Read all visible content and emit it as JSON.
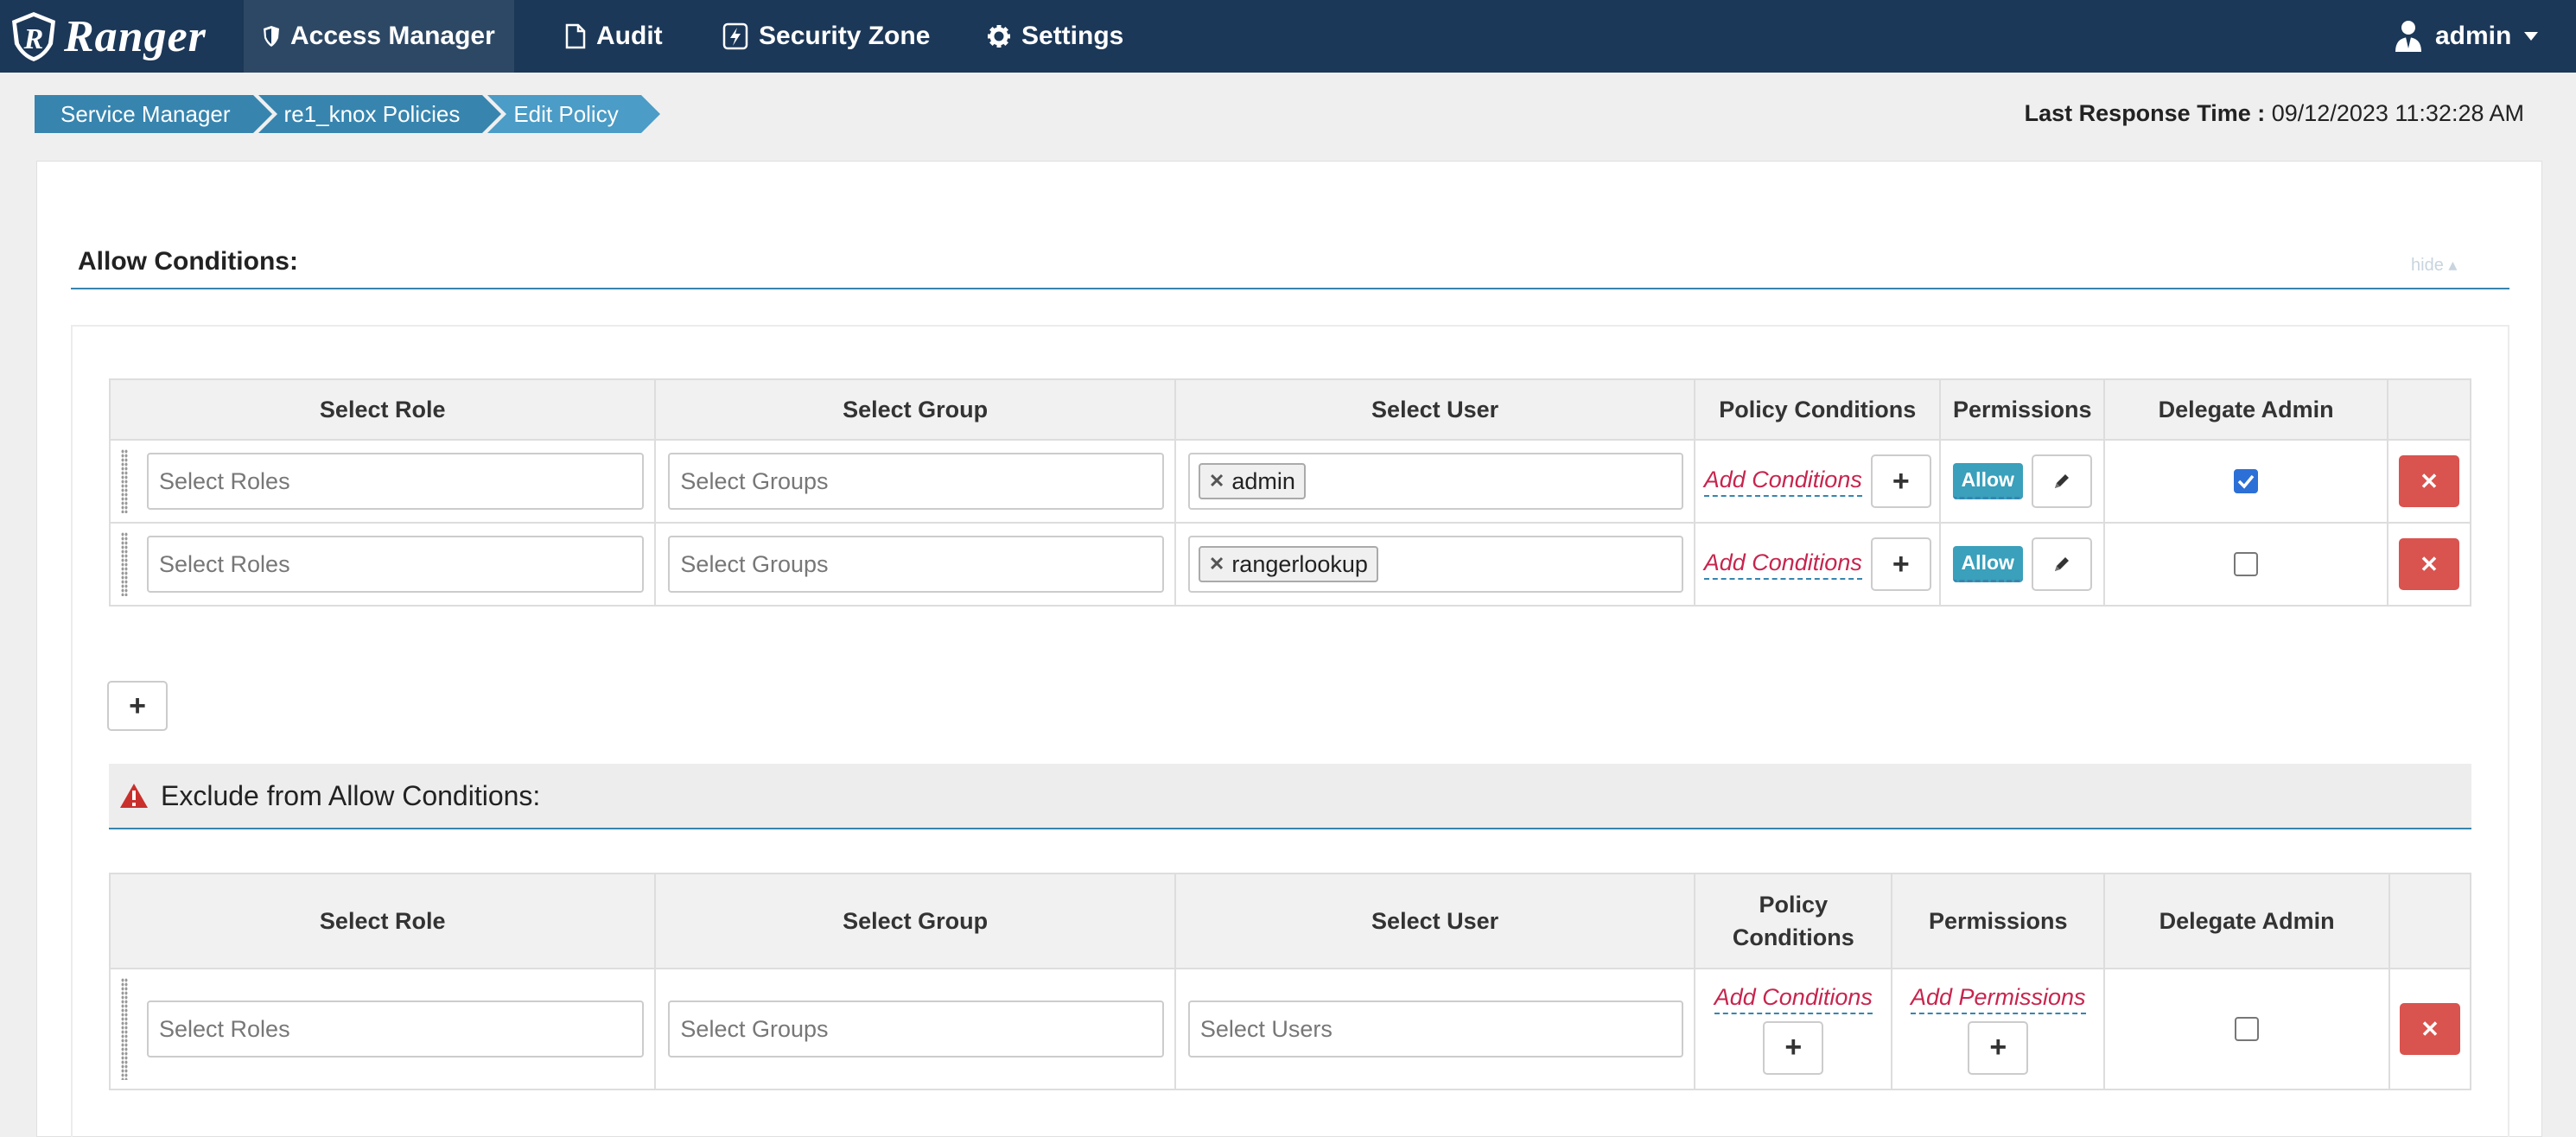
{
  "nav": {
    "brand": "Ranger",
    "items": [
      {
        "label": "Access Manager",
        "icon": "shield-icon"
      },
      {
        "label": "Audit",
        "icon": "file-icon"
      },
      {
        "label": "Security Zone",
        "icon": "bolt-icon"
      },
      {
        "label": "Settings",
        "icon": "gear-icon"
      }
    ],
    "user": "admin"
  },
  "breadcrumb": [
    "Service Manager",
    "re1_knox Policies",
    "Edit Policy"
  ],
  "last_response": {
    "label": "Last Response Time :",
    "value": "09/12/2023 11:32:28 AM"
  },
  "allow": {
    "title": "Allow Conditions:",
    "hide_label": "hide",
    "headers": [
      "Select Role",
      "Select Group",
      "Select User",
      "Policy Conditions",
      "Permissions",
      "Delegate Admin"
    ],
    "rows": [
      {
        "roles_placeholder": "Select Roles",
        "groups_placeholder": "Select Groups",
        "user": "admin",
        "conditions": "Add Conditions",
        "permission": "Allow",
        "delegate": true
      },
      {
        "roles_placeholder": "Select Roles",
        "groups_placeholder": "Select Groups",
        "user": "rangerlookup",
        "conditions": "Add Conditions",
        "permission": "Allow",
        "delegate": false
      }
    ]
  },
  "exclude": {
    "title": "Exclude from Allow Conditions:",
    "headers": [
      "Select Role",
      "Select Group",
      "Select User",
      "Policy Conditions",
      "Permissions",
      "Delegate Admin"
    ],
    "rows": [
      {
        "roles_placeholder": "Select Roles",
        "groups_placeholder": "Select Groups",
        "users_placeholder": "Select Users",
        "conditions": "Add Conditions",
        "permissions": "Add Permissions",
        "delegate": false
      }
    ]
  },
  "colors": {
    "nav": "#1c3858",
    "accent": "#3785af",
    "danger": "#d9534f",
    "allow": "#3aa0bb"
  }
}
